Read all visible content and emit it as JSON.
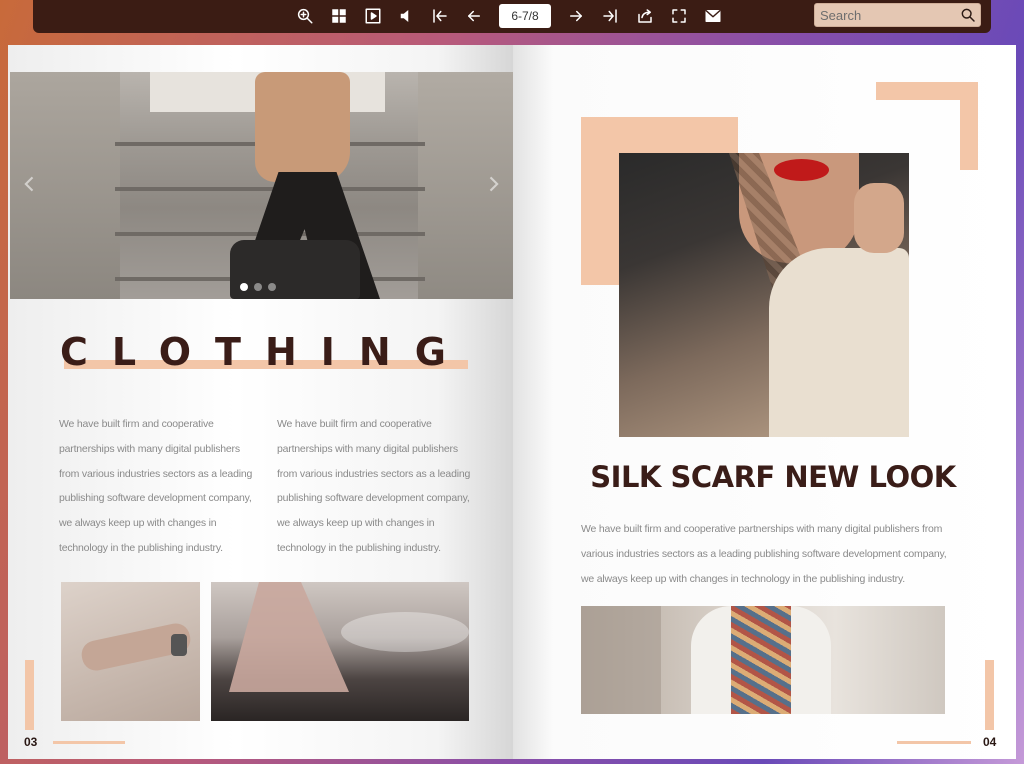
{
  "toolbar": {
    "icons": [
      "zoom-in-icon",
      "thumbnails-icon",
      "autoplay-icon",
      "sound-icon",
      "first-page-icon",
      "previous-page-icon",
      "next-page-icon",
      "last-page-icon",
      "share-icon",
      "fullscreen-icon",
      "email-icon"
    ],
    "page_indicator": "6-7/8",
    "search_placeholder": "Search"
  },
  "colors": {
    "toolbar_bg": "#3b1c14",
    "accent_peach": "#f3c6a8",
    "title_dark_brown": "#3a1d18"
  },
  "left_page": {
    "slider": {
      "dot_count": 3,
      "active_dot": 1
    },
    "title": "CLOTHING",
    "column_1": [
      "We have built firm and cooperative",
      "partnerships with many digital publishers",
      "from various industries sectors as a leading",
      "publishing software development company,",
      "we always keep up with changes in",
      "technology in the publishing industry."
    ],
    "column_2": [
      "We have built firm and cooperative",
      "partnerships with many digital publishers",
      "from various industries sectors as a leading",
      "publishing software development company,",
      "we always keep up with changes in",
      "technology in the publishing industry."
    ],
    "page_number": "03"
  },
  "right_page": {
    "title": "SILK SCARF NEW LOOK",
    "body": [
      "We have built firm and cooperative partnerships with many digital publishers from",
      "various industries sectors as a leading publishing software development company,",
      "we always keep up with changes in technology in the publishing industry."
    ],
    "page_number": "04"
  }
}
